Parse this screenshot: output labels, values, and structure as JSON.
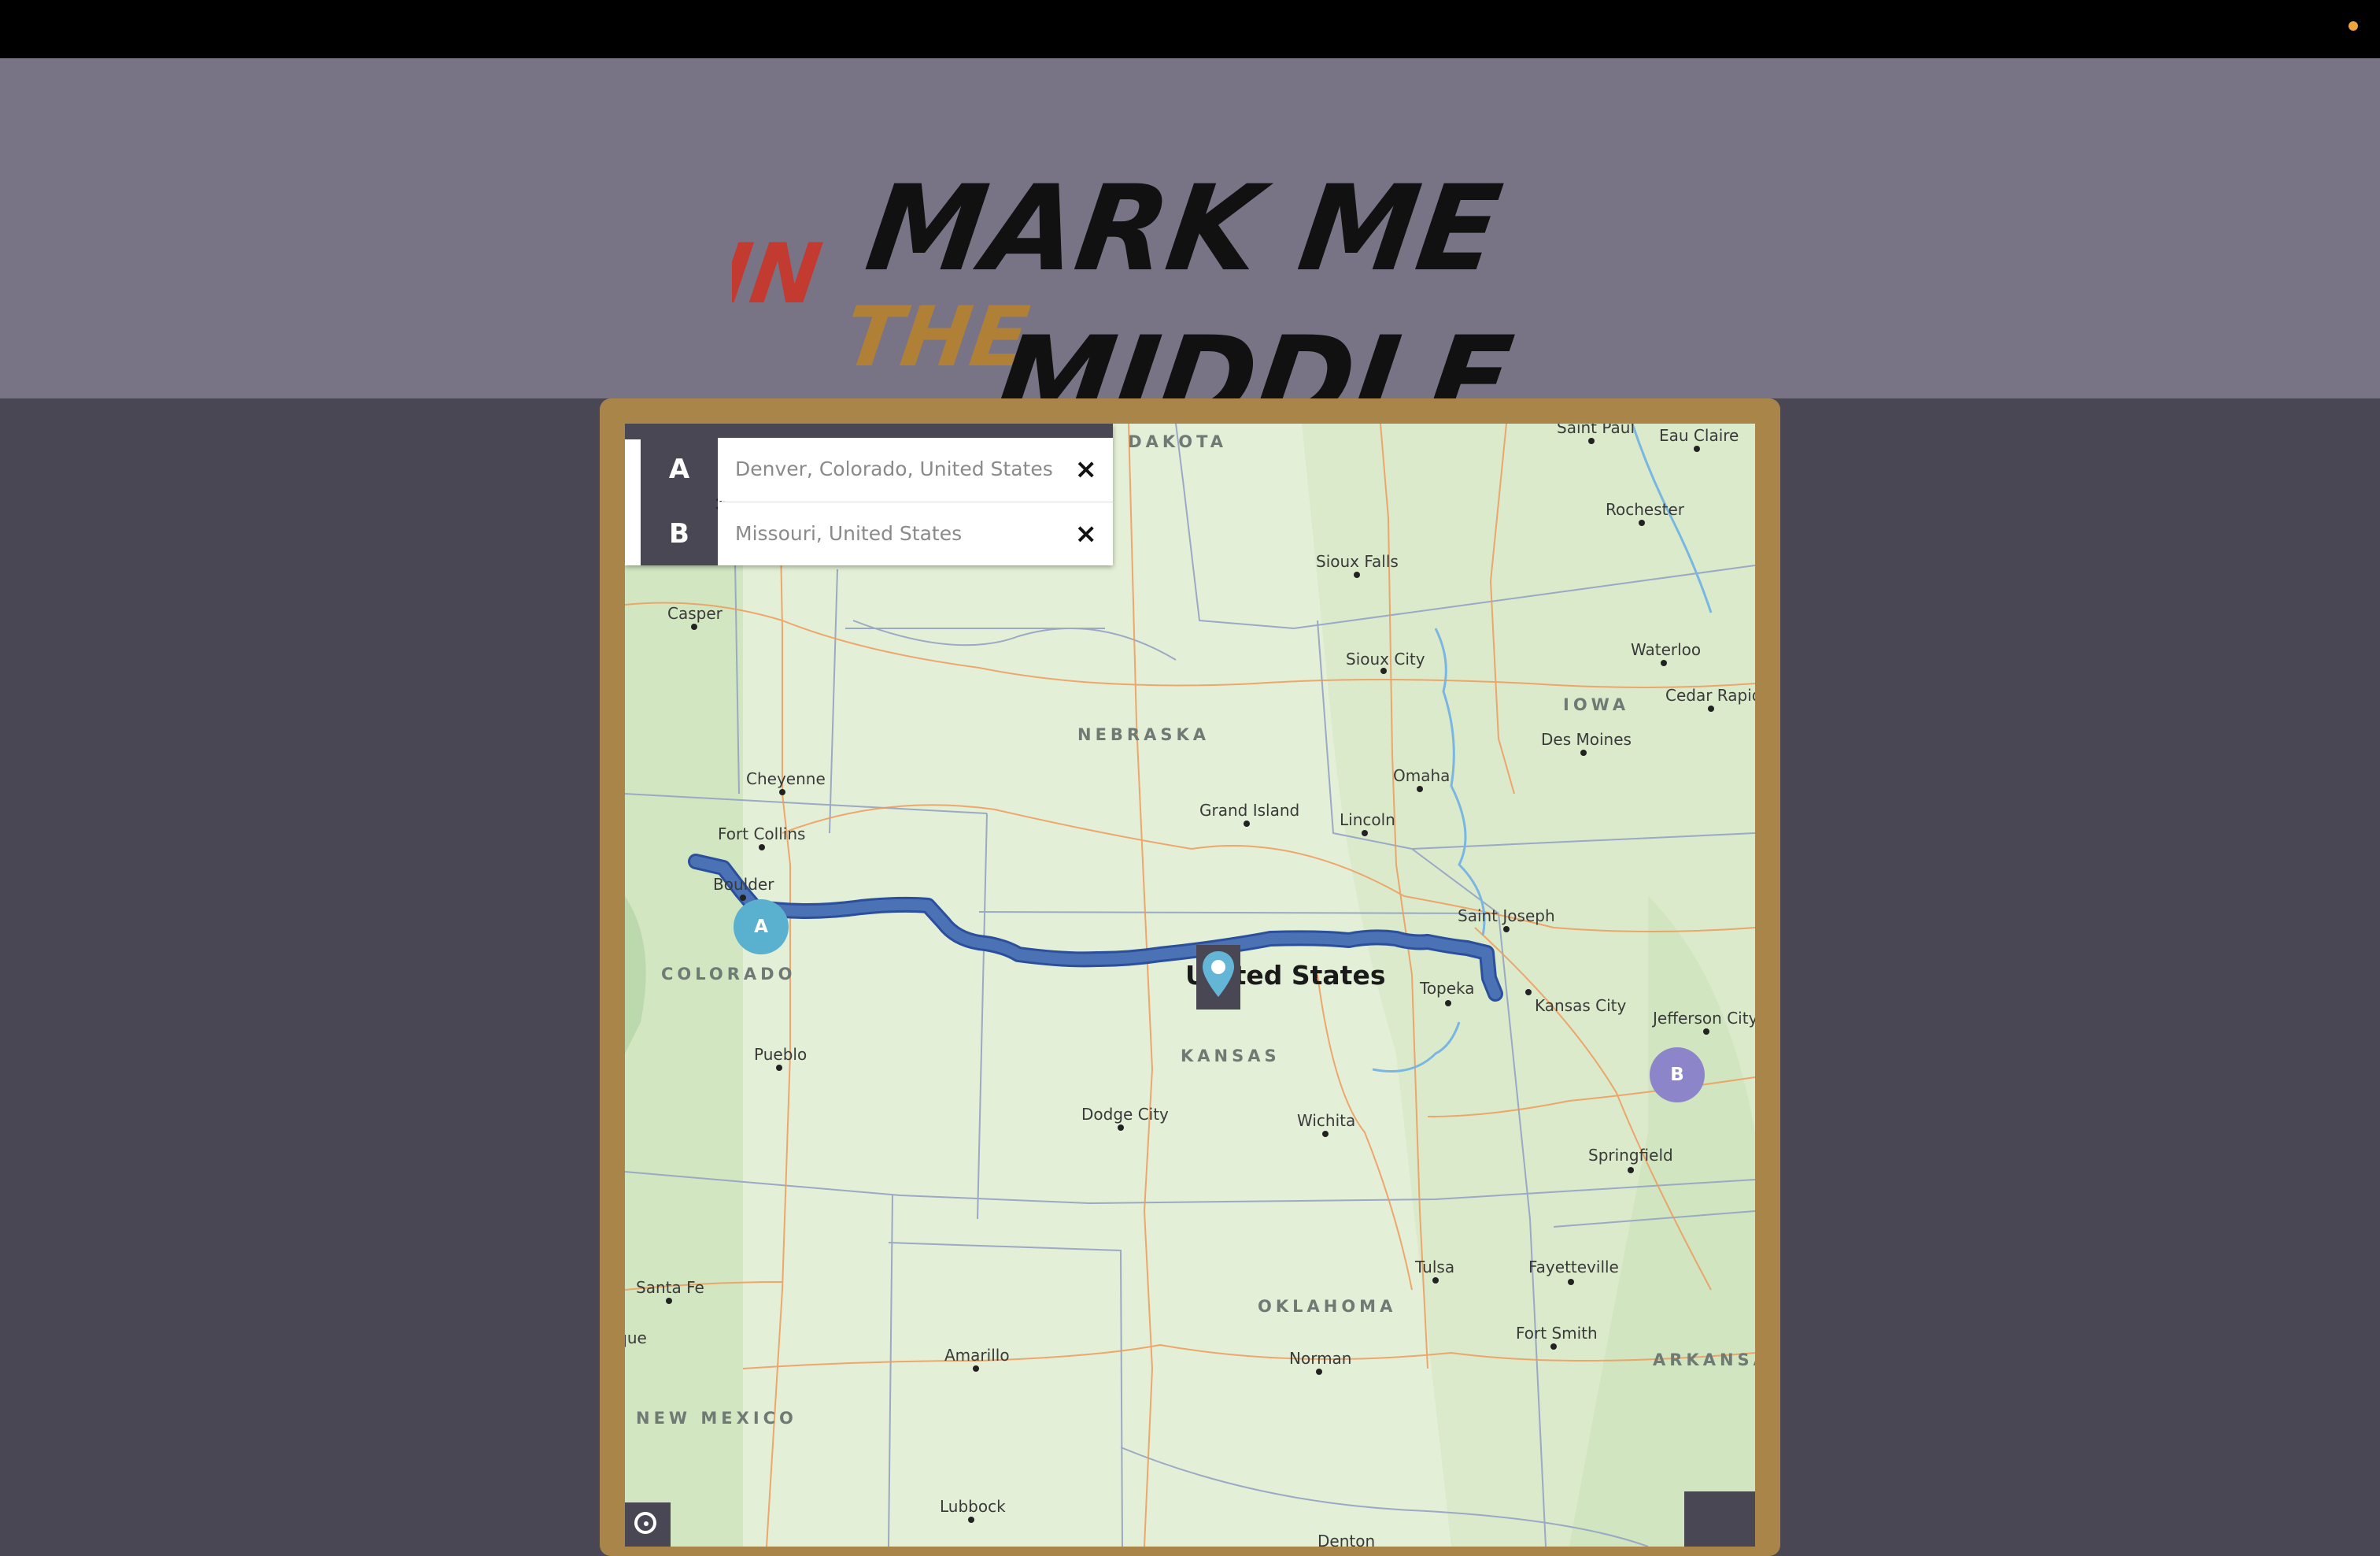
{
  "app": {
    "logo_words": [
      "IN",
      "THE",
      "MARK ME",
      "MIDDLE"
    ]
  },
  "route": {
    "a_letter": "A",
    "b_letter": "B",
    "a_value": "Denver, Colorado, United States",
    "b_value": "Missouri, United States",
    "clear_icon": "×"
  },
  "map": {
    "states": [
      "SOUTH DAKOTA",
      "NEBRASKA",
      "IOWA",
      "COLORADO",
      "KANSAS",
      "OKLAHOMA",
      "ARKANSAS",
      "NEW MEXICO"
    ],
    "cities": [
      "Saint Paul",
      "Eau Claire",
      "Rochester",
      "Sioux Falls",
      "Casper",
      "Sioux City",
      "Waterloo",
      "Cedar Rapids",
      "Des Moines",
      "Omaha",
      "Cheyenne",
      "Grand Island",
      "Lincoln",
      "Fort Collins",
      "Boulder",
      "Saint Joseph",
      "Topeka",
      "Kansas City",
      "Jefferson City",
      "Pueblo",
      "Dodge City",
      "Wichita",
      "Springfield",
      "Tulsa",
      "Fayetteville",
      "Santa Fe",
      "Albuquerque",
      "Amarillo",
      "Norman",
      "Fort Smith",
      "Lubbock",
      "Denton"
    ],
    "country_label": "United States",
    "marker_a": "A",
    "marker_b": "B"
  },
  "colors": {
    "header_bg": "#787485",
    "page_bg": "#4a4755",
    "frame": "#a98549",
    "route_line": "#4a72b4",
    "marker_a": "#5ab0cf",
    "marker_b": "#8d85c9",
    "accent_dot": "#f0a53a"
  },
  "icons": {
    "swap": "swap-vertical-icon",
    "clear": "close-icon",
    "pin": "map-pin-icon",
    "geolocate": "geolocate-icon"
  }
}
